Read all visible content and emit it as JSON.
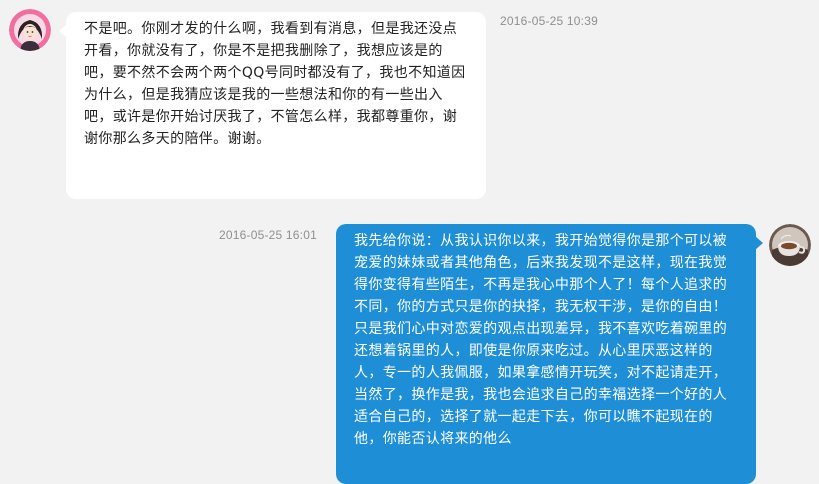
{
  "messages": [
    {
      "sender": "other",
      "avatar_icon": "user-avatar-girl-icon",
      "timestamp": "2016-05-25 10:39",
      "text": "不是吧。你刚才发的什么啊，我看到有消息，但是我还没点开看，你就没有了，你是不是把我删除了，我想应该是的吧，要不然不会两个两个QQ号同时都没有了，我也不知道因为什么，但是我猜应该是我的一些想法和你的有一些出入吧，或许是你开始讨厌我了，不管怎么样，我都尊重你，谢谢你那么多天的陪伴。谢谢。"
    },
    {
      "sender": "self",
      "avatar_icon": "user-avatar-cup-icon",
      "timestamp": "2016-05-25 16:01",
      "text": "我先给你说：从我认识你以来，我开始觉得你是那个可以被宠爱的妹妹或者其他角色，后来我发现不是这样，现在我觉得你变得有些陌生，不再是我心中那个人了！每个人追求的不同，你的方式只是你的抉择，我无权干涉，是你的自由！只是我们心中对恋爱的观点出现差异，我不喜欢吃着碗里的还想着锅里的人，即使是你原来吃过。从心里厌恶这样的人，专一的人我佩服，如果拿感情开玩笑，对不起请走开，当然了，换作是我，我也会追求自己的幸福选择一个好的人适合自己的，选择了就一起走下去，你可以瞧不起现在的他，你能否认将来的他么"
    }
  ],
  "colors": {
    "background": "#f2f2f2",
    "incoming_bubble": "#ffffff",
    "outgoing_bubble": "#1e8fd6",
    "timestamp": "#8f8f8f"
  }
}
